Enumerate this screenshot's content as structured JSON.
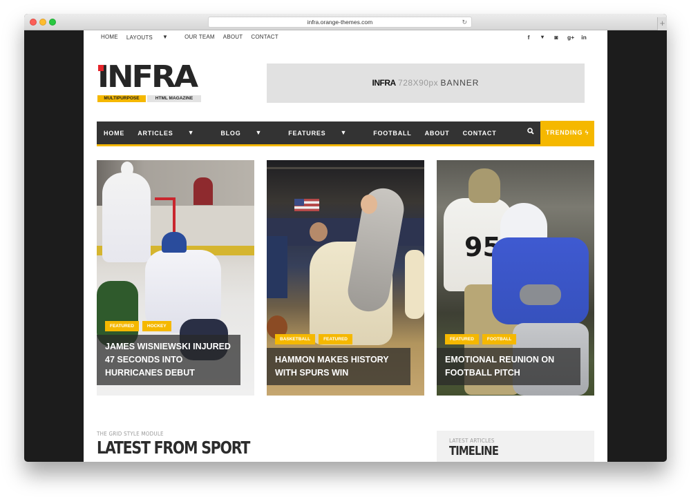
{
  "browser": {
    "url": "infra.orange-themes.com",
    "reload_icon": "reload-icon",
    "new_tab_label": "+"
  },
  "topbar": {
    "nav": [
      {
        "label": "HOME"
      },
      {
        "label": "LAYOUTS",
        "dropdown": true
      },
      {
        "label": "OUR TEAM"
      },
      {
        "label": "ABOUT"
      },
      {
        "label": "CONTACT"
      }
    ],
    "social": [
      {
        "icon": "facebook-icon",
        "glyph": "f"
      },
      {
        "icon": "twitter-icon",
        "glyph": "🐦"
      },
      {
        "icon": "instagram-icon",
        "glyph": "◙"
      },
      {
        "icon": "google-plus-icon",
        "glyph": "g+"
      },
      {
        "icon": "linkedin-icon",
        "glyph": "in"
      }
    ]
  },
  "logo": {
    "text": "INFRA",
    "tag1": "MULTIPURPOSE",
    "tag2": "HTML MAGAZINE",
    "accent": "#e5242a"
  },
  "banner": {
    "logo": "INFRA",
    "size": "728X90px",
    "word": "BANNER"
  },
  "mainnav": {
    "items": [
      {
        "label": "HOME"
      },
      {
        "label": "ARTICLES",
        "dropdown": true
      },
      {
        "label": "BLOG",
        "dropdown": true
      },
      {
        "label": "FEATURES",
        "dropdown": true
      },
      {
        "label": "FOOTBALL"
      },
      {
        "label": "ABOUT"
      },
      {
        "label": "CONTACT"
      }
    ],
    "search_icon": "⚲",
    "trending_label": "TRENDING",
    "trending_icon": "ϟ"
  },
  "cards": [
    {
      "tags": [
        "FEATURED",
        "HOCKEY"
      ],
      "title": "JAMES WISNIEWSKI INJURED 47 SECONDS INTO HURRICANES DEBUT",
      "image": "hockey players on ice"
    },
    {
      "tags": [
        "BASKETBALL",
        "FEATURED"
      ],
      "title": "HAMMON MAKES HISTORY WITH SPURS WIN",
      "image": "navy basketball player dribbling"
    },
    {
      "tags": [
        "FEATURED",
        "FOOTBALL"
      ],
      "title": "EMOTIONAL REUNION ON FOOTBALL PITCH",
      "image": "air force football player running"
    }
  ],
  "section": {
    "kicker": "THE GRID STYLE MODULE",
    "title": "LATEST FROM SPORT"
  },
  "sidebar": {
    "kicker": "LATEST ARTICLES",
    "title": "TIMELINE"
  },
  "colors": {
    "accent": "#f5b800",
    "nav_bg": "#333333",
    "logo_red": "#e5242a"
  }
}
